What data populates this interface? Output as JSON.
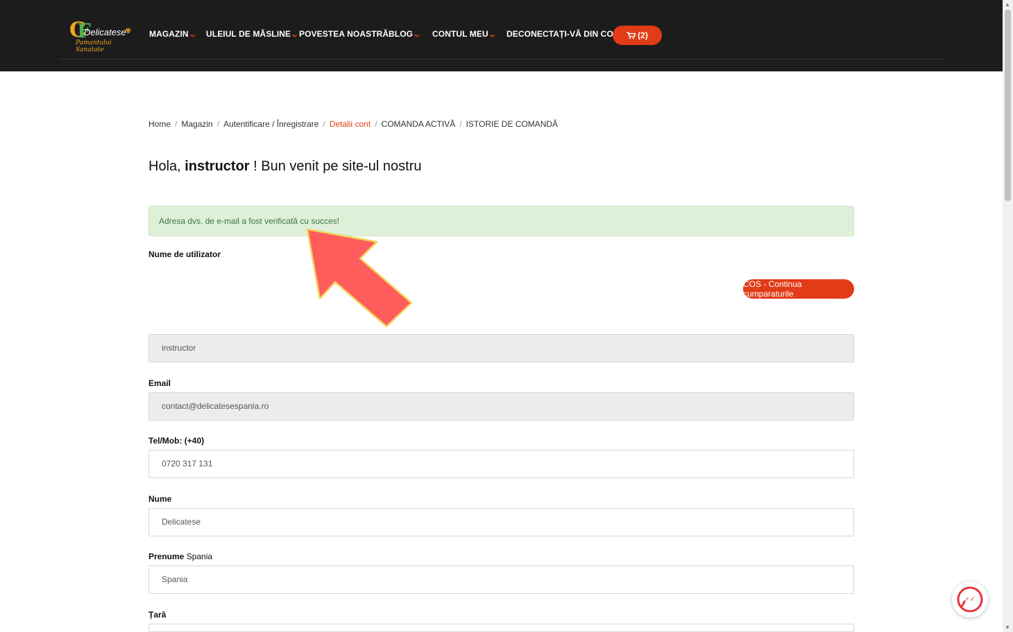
{
  "colors": {
    "accent": "#e23b17",
    "header_bg": "#1c1c1c",
    "success_bg": "#dff0d8",
    "success_text": "#3c763d",
    "annotation_arrow": "#ff5c5c"
  },
  "logo": {
    "name": "Delicatese",
    "tagline": "Pamantului Sanatate"
  },
  "nav": {
    "items": [
      {
        "label": "MAGAZIN",
        "has_dropdown": true
      },
      {
        "label": "ULEIUL DE MĂSLINE",
        "has_dropdown": true
      },
      {
        "label": "POVESTEA NOASTRĂ",
        "has_dropdown": false
      },
      {
        "label": "BLOG",
        "has_dropdown": true
      },
      {
        "label": "CONTUL MEU",
        "has_dropdown": true
      },
      {
        "label": "DECONECTAȚI-VĂ DIN CONT",
        "has_dropdown": false
      }
    ],
    "dropdown_icon": "chevron-down-icon",
    "cart_label": "(2)",
    "cart_icon": "cart-icon"
  },
  "breadcrumb": {
    "items": [
      {
        "label": "Home",
        "active": false
      },
      {
        "label": "Magazin",
        "active": false
      },
      {
        "label": "Autentificare / Înregistrare",
        "active": false
      },
      {
        "label": "Detalii cont",
        "active": true
      },
      {
        "label": "COMANDA ACTIVĂ",
        "active": false
      },
      {
        "label": "ISTORIE DE COMANDĂ",
        "active": false
      }
    ],
    "separator": "/"
  },
  "greeting": {
    "prefix": "Hola, ",
    "username": "instructor",
    "suffix": " ! Bun venit pe site-ul nostru"
  },
  "alert": {
    "message": "Adresa dvs. de e-mail a fost verificată cu succes!"
  },
  "actions": {
    "continue_shopping": "COS - Continua cumparaturile"
  },
  "form": {
    "username_label": "Nume de utilizator",
    "username_value": "instructor",
    "email_label": "Email",
    "email_value": "contact@delicatesespania.ro",
    "phone_label": "Tel/Mob: (+40)",
    "phone_value": "0720 317 131",
    "lastname_label": "Nume",
    "lastname_value": "Delicatese",
    "firstname_label": "Prenume",
    "firstname_label_extra": "Spania",
    "firstname_value": "Spania",
    "country_label": "Țară"
  },
  "widgets": {
    "messenger_icon": "messenger-icon"
  }
}
